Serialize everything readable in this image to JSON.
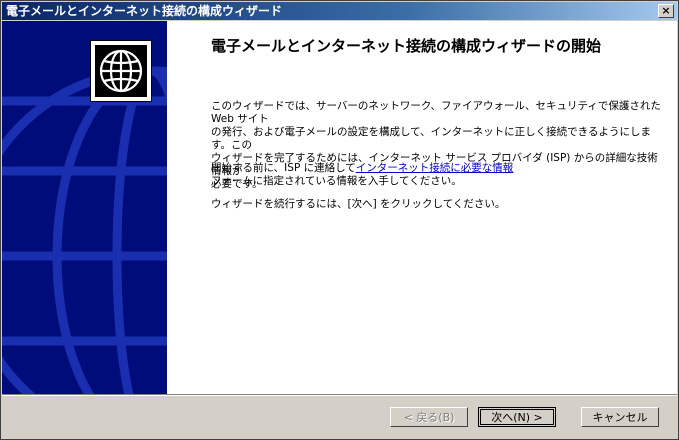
{
  "window": {
    "title": "電子メールとインターネット接続の構成ウィザード",
    "close_label": "×"
  },
  "content": {
    "heading": "電子メールとインターネット接続の構成ウィザードの開始",
    "paragraph1_line1": "このウィザードでは、サーバーのネットワーク、ファイアウォール、セキュリティで保護された Web サイト",
    "paragraph1_line2": "の発行、および電子メールの設定を構成して、インターネットに正しく接続できるようにします。この",
    "paragraph1_line3": "ウィザードを完了するためには、インターネット サービス プロバイダ (ISP) からの詳細な技術情報が",
    "paragraph1_line4": "必要です。",
    "paragraph2_prefix": "開始する前に、ISP に連絡して",
    "paragraph2_link": "インターネット接続に必要な情報",
    "paragraph2_line2": "フォームに指定されている情報を入手してください。",
    "paragraph3": "ウィザードを続行するには、[次へ] をクリックしてください。"
  },
  "buttons": {
    "back": "< 戻る(B)",
    "next": "次へ(N) >",
    "cancel": "キャンセル"
  },
  "icons": {
    "banner_icon": "globe-icon"
  },
  "colors": {
    "title_bar": "#0a246a",
    "banner": "#000c7a",
    "link": "#0000cc"
  }
}
